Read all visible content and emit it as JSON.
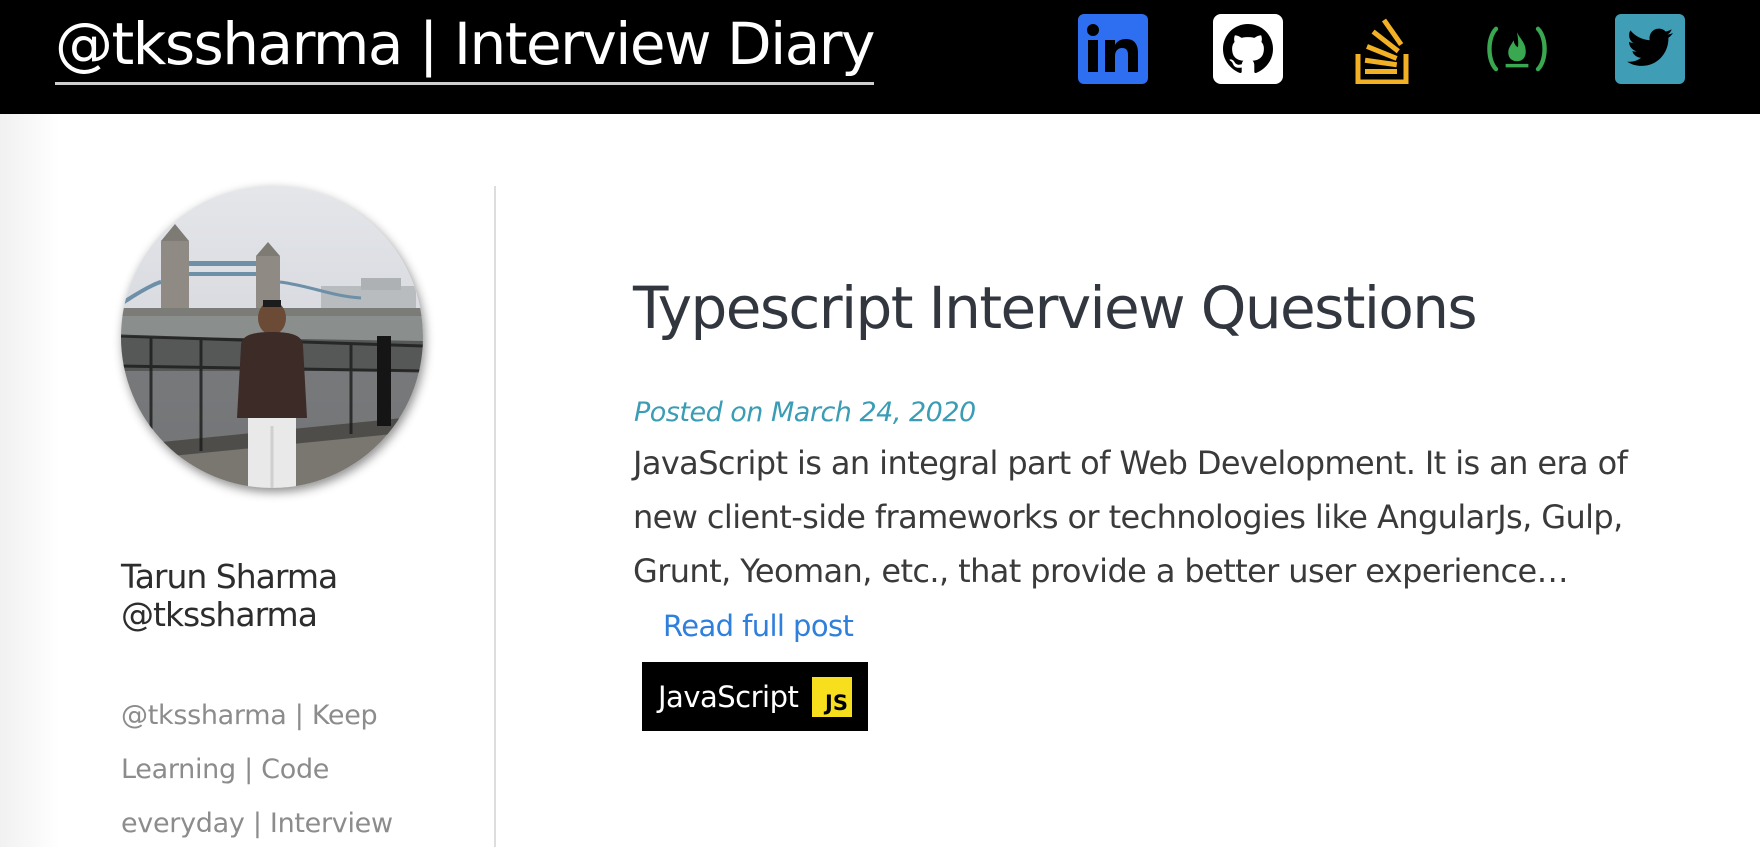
{
  "header": {
    "site_title": "@tkssharma | Interview Diary",
    "social_links": [
      {
        "name": "linkedin-icon",
        "color": "#2d6ff0"
      },
      {
        "name": "github-icon",
        "color": "#ffffff"
      },
      {
        "name": "stackoverflow-icon",
        "color": "#f2b124"
      },
      {
        "name": "freecodecamp-icon",
        "color": "#39a850"
      },
      {
        "name": "twitter-icon",
        "color": "#3f9eb6"
      }
    ]
  },
  "sidebar": {
    "author_name": "Tarun Sharma @tkssharma",
    "bio": "@tkssharma | Keep Learning | Code everyday | Interview"
  },
  "post": {
    "title": "Typescript Interview Questions",
    "date": "Posted on March 24, 2020",
    "excerpt": "JavaScript is an integral part of Web Development. It is an era of new client-side frameworks or technologies like AngularJs, Gulp, Grunt, Yeoman, etc., that provide a better user experience…",
    "read_more": "Read full post",
    "tag": {
      "label": "JavaScript",
      "logo_text": "JS",
      "logo_color": "#f7df1e"
    }
  },
  "colors": {
    "header_bg": "#000000",
    "title_text": "#32363e",
    "date_text": "#3a9db5",
    "link": "#2f7fdc"
  }
}
